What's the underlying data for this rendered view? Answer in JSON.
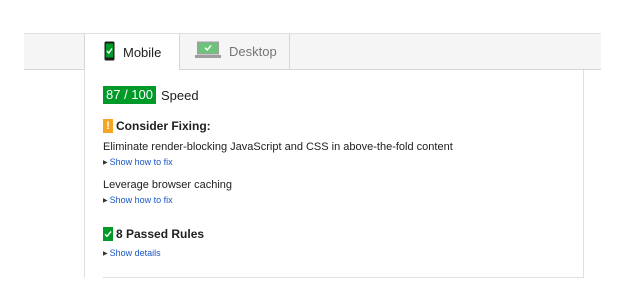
{
  "tabs": [
    {
      "label": "Mobile",
      "icon": "phone-icon",
      "active": true
    },
    {
      "label": "Desktop",
      "icon": "monitor-icon",
      "active": false
    }
  ],
  "score": {
    "value": "87 / 100",
    "label": "Speed",
    "color": "#009a29"
  },
  "consider": {
    "heading": "Consider Fixing:",
    "icon": "warning-icon",
    "color": "#f6a623",
    "rules": [
      {
        "text": "Eliminate render-blocking JavaScript and CSS in above-the-fold content",
        "link": "Show how to fix"
      },
      {
        "text": "Leverage browser caching",
        "link": "Show how to fix"
      }
    ]
  },
  "passed": {
    "heading": "8 Passed Rules",
    "icon": "check-icon",
    "link": "Show details"
  }
}
